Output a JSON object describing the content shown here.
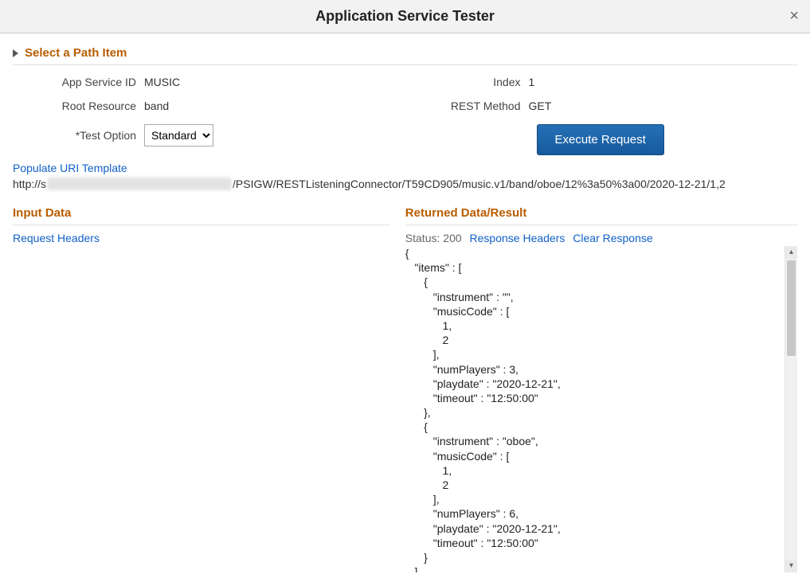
{
  "title": "Application Service Tester",
  "expander_label": "Select a Path Item",
  "form": {
    "app_service_id_label": "App Service ID",
    "app_service_id_value": "MUSIC",
    "root_resource_label": "Root Resource",
    "root_resource_value": "band",
    "test_option_label": "*Test Option",
    "test_option_value": "Standard",
    "index_label": "Index",
    "index_value": "1",
    "rest_method_label": "REST Method",
    "rest_method_value": "GET",
    "execute_button": "Execute Request"
  },
  "populate_link": "Populate URI Template",
  "url_prefix": "http://s",
  "url_suffix": "/PSIGW/RESTListeningConnector/T59CD905/music.v1/band/oboe/12%3a50%3a00/2020-12-21/1,2",
  "sections": {
    "input_data": "Input Data",
    "returned_data": "Returned Data/Result"
  },
  "request_headers_link": "Request Headers",
  "status_label": "Status:",
  "status_code": "200",
  "response_headers_link": "Response Headers",
  "clear_response_link": "Clear Response",
  "result_json": "{\n   \"items\" : [\n      {\n         \"instrument\" : \"\",\n         \"musicCode\" : [\n            1,\n            2\n         ],\n         \"numPlayers\" : 3,\n         \"playdate\" : \"2020-12-21\",\n         \"timeout\" : \"12:50:00\"\n      },\n      {\n         \"instrument\" : \"oboe\",\n         \"musicCode\" : [\n            1,\n            2\n         ],\n         \"numPlayers\" : 6,\n         \"playdate\" : \"2020-12-21\",\n         \"timeout\" : \"12:50:00\"\n      }\n   ]\n}"
}
